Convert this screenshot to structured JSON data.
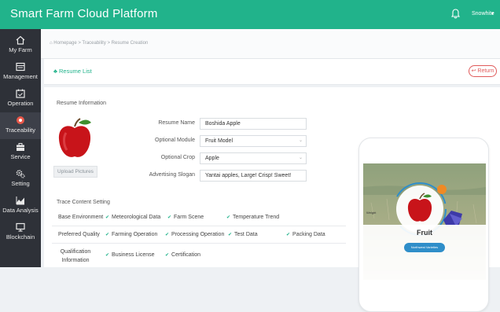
{
  "header": {
    "title": "Smart Farm Cloud Platform",
    "user": "Snowhite",
    "user_caret": "▾",
    "bell_icon": "bell-icon"
  },
  "sidebar": {
    "items": [
      {
        "label": "My Farm",
        "icon": "home-icon"
      },
      {
        "label": "Management",
        "icon": "management-icon"
      },
      {
        "label": "Operation",
        "icon": "calendar-icon"
      },
      {
        "label": "Traceability",
        "icon": "traceability-icon",
        "active": true
      },
      {
        "label": "Service",
        "icon": "briefcase-icon"
      },
      {
        "label": "Setting",
        "icon": "gears-icon"
      },
      {
        "label": "Data Analysis",
        "icon": "chart-icon"
      },
      {
        "label": "Blockchain",
        "icon": "monitor-icon"
      }
    ]
  },
  "breadcrumb": "Homepage > Traceability > Resume Creation",
  "panel": {
    "title": "Resume List",
    "return_label": "Return",
    "return_icon": "↩"
  },
  "resume": {
    "section_title": "Resume Information",
    "upload_label": "Upload Pictures",
    "fields": {
      "name_label": "Resume Name",
      "name_value": "Boshida Apple",
      "module_label": "Optional Module",
      "module_value": "Fruit Model",
      "crop_label": "Optional Crop",
      "crop_value": "Apple",
      "slogan_label": "Advertising Slogan",
      "slogan_value": "Yantai apples, Large! Crisp! Sweet!"
    }
  },
  "trace": {
    "section_title": "Trace Content Setting",
    "base_label": "Base Environment",
    "base_items": [
      "Meteorological Data",
      "Farm Scene",
      "Temperature Trend"
    ],
    "preferred_label": "Preferred Quality",
    "preferred_items": [
      "Farming Operation",
      "Processing Operation",
      "Test Data",
      "Packing Data"
    ],
    "qualification_label": "Qualification Information",
    "qualification_items": [
      "Business License",
      "Certification"
    ],
    "tick": "✔"
  },
  "preview": {
    "fruit_label": "Fruit",
    "button_label": "Northwest Varieties",
    "side_text": "Weight"
  },
  "colors": {
    "brand": "#21b38b",
    "sidebar": "#2e3138",
    "return": "#e05a5a",
    "preview_button": "#2f8ec9"
  }
}
